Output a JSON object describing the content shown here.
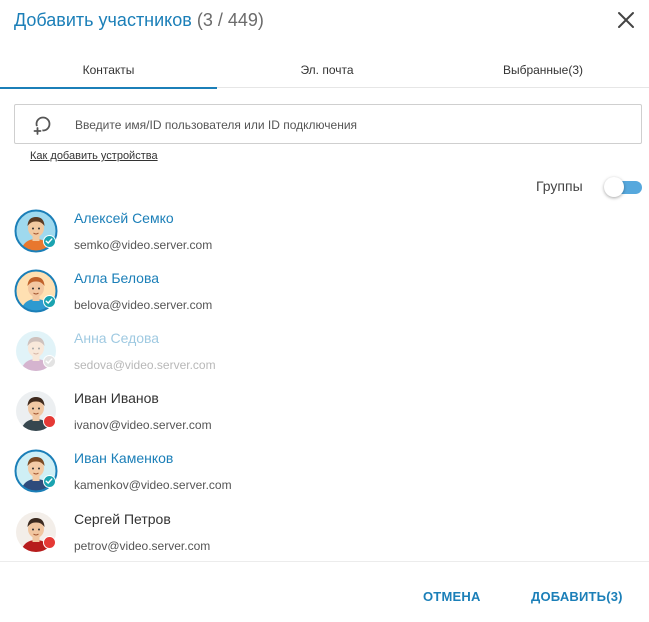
{
  "dialog": {
    "title": "Добавить участников",
    "count": "(3 / 449)"
  },
  "tabs": [
    {
      "label": "Контакты",
      "active": true
    },
    {
      "label": "Эл. почта",
      "active": false
    },
    {
      "label": "Выбранные(3)",
      "active": false
    }
  ],
  "search": {
    "placeholder": "Введите имя/ID пользователя или ID подключения",
    "value": "",
    "icon": "add-user-search-icon"
  },
  "how_link": "Как добавить устройства",
  "groups": {
    "label": "Группы",
    "enabled": false
  },
  "contacts": [
    {
      "name": "Алексей Семко",
      "email": "semko@video.server.com",
      "status": "online",
      "selected": true,
      "avatar_bg": "#9fd9ee",
      "skin": "#f2c9a0",
      "hair": "#5a3a22",
      "shirt": "#e8772e"
    },
    {
      "name": "Алла Белова",
      "email": "belova@video.server.com",
      "status": "online",
      "selected": true,
      "avatar_bg": "#ffe0b2",
      "skin": "#f3c8a2",
      "hair": "#c0622b",
      "shirt": "#2e9ad0"
    },
    {
      "name": "Анна Седова",
      "email": "sedova@video.server.com",
      "status": "offline",
      "selected": false,
      "avatar_bg": "#b9e3ef",
      "skin": "#f0c9a8",
      "hair": "#8d6e63",
      "shirt": "#9c4f8e"
    },
    {
      "name": "Иван Иванов",
      "email": "ivanov@video.server.com",
      "status": "busy",
      "selected": false,
      "avatar_bg": "#eceff1",
      "skin": "#f1c9a5",
      "hair": "#3e2a1e",
      "shirt": "#37474f"
    },
    {
      "name": "Иван Каменков",
      "email": "kamenkov@video.server.com",
      "status": "online",
      "selected": true,
      "avatar_bg": "#cfeff5",
      "skin": "#f3cba6",
      "hair": "#7a4a24",
      "shirt": "#2f4b7c"
    },
    {
      "name": "Сергей Петров",
      "email": "petrov@video.server.com",
      "status": "busy",
      "selected": false,
      "avatar_bg": "#f3eee9",
      "skin": "#f1c6a0",
      "hair": "#3b2a20",
      "shirt": "#b71c1c"
    }
  ],
  "buttons": {
    "cancel": "ОТМЕНА",
    "add": "ДОБАВИТЬ(3)"
  },
  "colors": {
    "accent": "#1b7fb8",
    "online": "#1aa3b0",
    "busy": "#e53935",
    "offline": "#bdbdbd",
    "toggle_track": "#56a8dd"
  }
}
